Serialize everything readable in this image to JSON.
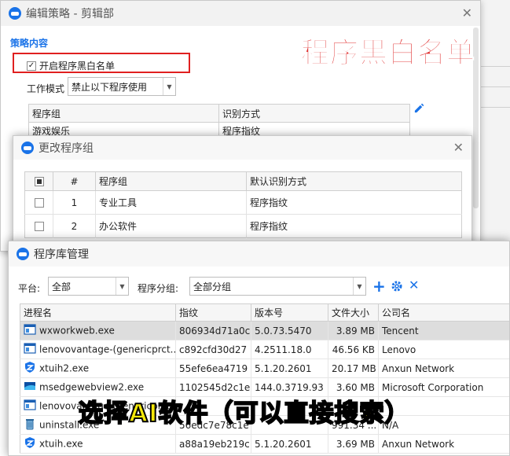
{
  "strategy_window": {
    "title": "编辑策略 - 剪辑部",
    "section_label": "策略内容",
    "enable_checkbox_label": "开启程序黑白名单",
    "enable_checked": true,
    "mode_label": "工作模式",
    "mode_value": "禁止以下程序使用",
    "table_headers": [
      "程序组",
      "识别方式"
    ],
    "table_rows": [
      [
        "游戏娱乐",
        "程序指纹"
      ]
    ]
  },
  "group_dialog": {
    "title": "更改程序组",
    "headers": [
      "#",
      "程序组",
      "默认识别方式"
    ],
    "rows": [
      {
        "num": "1",
        "group": "专业工具",
        "method": "程序指纹"
      },
      {
        "num": "2",
        "group": "办公软件",
        "method": "程序指纹"
      }
    ]
  },
  "library_dialog": {
    "title": "程序库管理",
    "platform_label": "平台:",
    "platform_value": "全部",
    "group_label": "程序分组:",
    "group_value": "全部分组",
    "headers": [
      "进程名",
      "指纹",
      "版本号",
      "文件大小",
      "公司名"
    ],
    "rows": [
      {
        "name": "wxworkweb.exe",
        "fingerprint": "806934d71a0c",
        "version": "5.0.73.5470",
        "size": "3.89 MB",
        "company": "Tencent",
        "icon": "window-icon",
        "selected": true
      },
      {
        "name": "lenovovantage-(genericprct...",
        "fingerprint": "c892cfd30d27",
        "version": "4.2511.18.0",
        "size": "46.56 KB",
        "company": "Lenovo",
        "icon": "window-icon",
        "selected": false
      },
      {
        "name": "xtuih2.exe",
        "fingerprint": "55efe6ea4719",
        "version": "5.1.20.2601",
        "size": "20.17 MB",
        "company": "Anxun Network",
        "icon": "shield-icon",
        "selected": false
      },
      {
        "name": "msedgewebview2.exe",
        "fingerprint": "1102545d2c1e",
        "version": "144.0.3719.93",
        "size": "3.60 MB",
        "company": "Microsoft Corporation",
        "icon": "edge-icon",
        "selected": false
      },
      {
        "name": "lenovovantage-(genericprct...",
        "fingerprint": "",
        "version": "",
        "size": "",
        "company": "",
        "icon": "window-icon",
        "selected": false
      },
      {
        "name": "uninstall.exe",
        "fingerprint": "56edc7e78c1e",
        "version": "",
        "size": "991.34 ...",
        "company": "N/A",
        "icon": "trash-icon",
        "selected": false
      },
      {
        "name": "xtuih.exe",
        "fingerprint": "a88a19eb219c",
        "version": "5.1.20.2601",
        "size": "3.69 MB",
        "company": "Anxun Network",
        "icon": "shield-icon",
        "selected": false
      }
    ]
  },
  "annotations": {
    "top_caption": "程序黑白名单",
    "bottom_caption": "选择AI软件（可以直接搜索）"
  },
  "colors": {
    "accent": "#1a73e8",
    "highlight_box": "#e02020",
    "top_caption": "#e03030",
    "bottom_caption": "#f4e80a",
    "row_selected": "#dddddd"
  }
}
